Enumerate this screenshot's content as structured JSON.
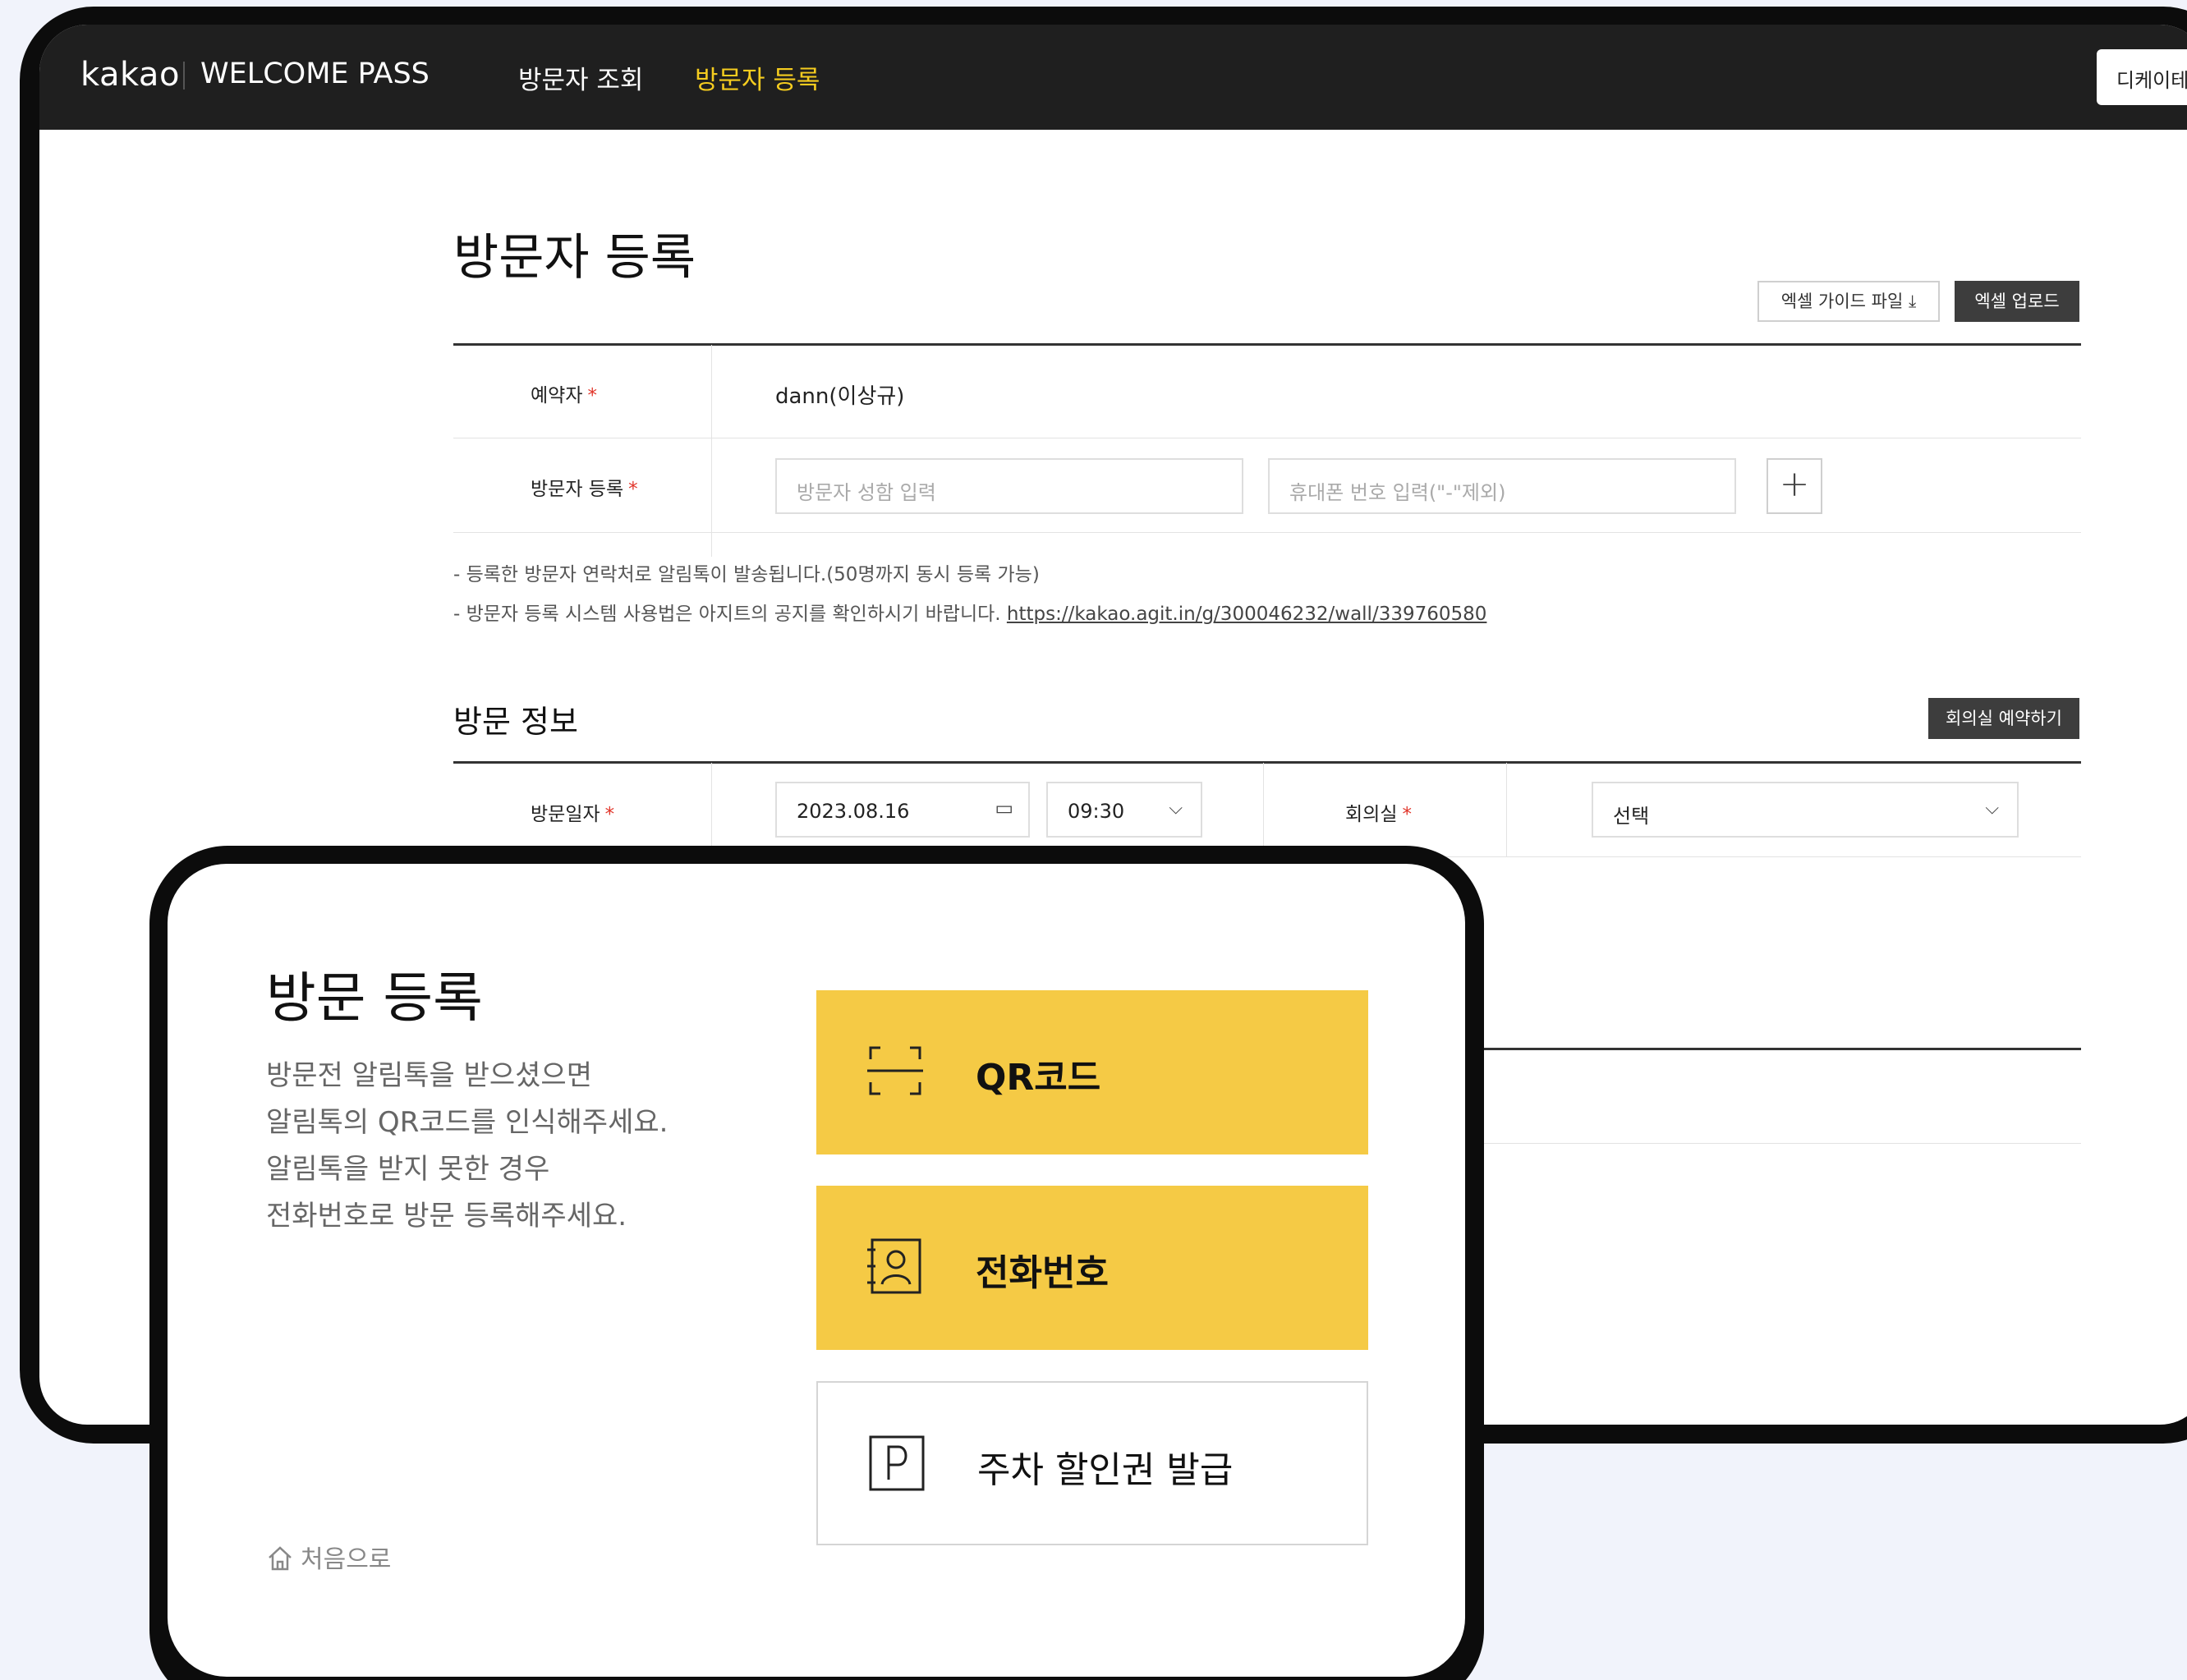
{
  "header": {
    "logo": "kakao",
    "product": "WELCOME PASS",
    "nav": [
      "방문자 조회",
      "방문자 등록"
    ],
    "user_button": "디케이테"
  },
  "page": {
    "title": "방문자 등록",
    "excel_guide_button": "엑셀 가이드 파일 ⤓",
    "excel_upload_button": "엑셀 업로드"
  },
  "form": {
    "reserver_label": "예약자",
    "reserver_value": "dann(이상규)",
    "visitor_label": "방문자 등록",
    "name_placeholder": "방문자 성함 입력",
    "phone_placeholder": "휴대폰 번호 입력(\"-\"제외)",
    "add_button": "+",
    "required_mark": "*"
  },
  "notices": {
    "line1": "- 등록한 방문자 연락처로 알림톡이 발송됩니다.(50명까지 동시 등록 가능)",
    "line2_prefix": "- 방문자 등록 시스템 사용법은 아지트의 공지를 확인하시기 바랍니다. ",
    "line2_link": "https://kakao.agit.in/g/300046232/wall/339760580"
  },
  "visit_info": {
    "section_title": "방문 정보",
    "room_reserve_button": "회의실 예약하기",
    "date_label": "방문일자",
    "date_value": "2023.08.16",
    "time_value": "09:30",
    "room_label": "회의실",
    "room_value": "선택"
  },
  "kiosk": {
    "title": "방문 등록",
    "desc": [
      "방문전 알림톡을 받으셨으면",
      "알림톡의 QR코드를 인식해주세요.",
      "알림톡을 받지 못한 경우",
      "전화번호로 방문 등록해주세요."
    ],
    "buttons": [
      {
        "label": "QR코드",
        "icon": "qr-scan-icon"
      },
      {
        "label": "전화번호",
        "icon": "contact-book-icon"
      },
      {
        "label": "주차 할인권 발급",
        "icon": "parking-icon"
      }
    ],
    "home_link": "처음으로",
    "accent_color": "#f5ca45"
  }
}
